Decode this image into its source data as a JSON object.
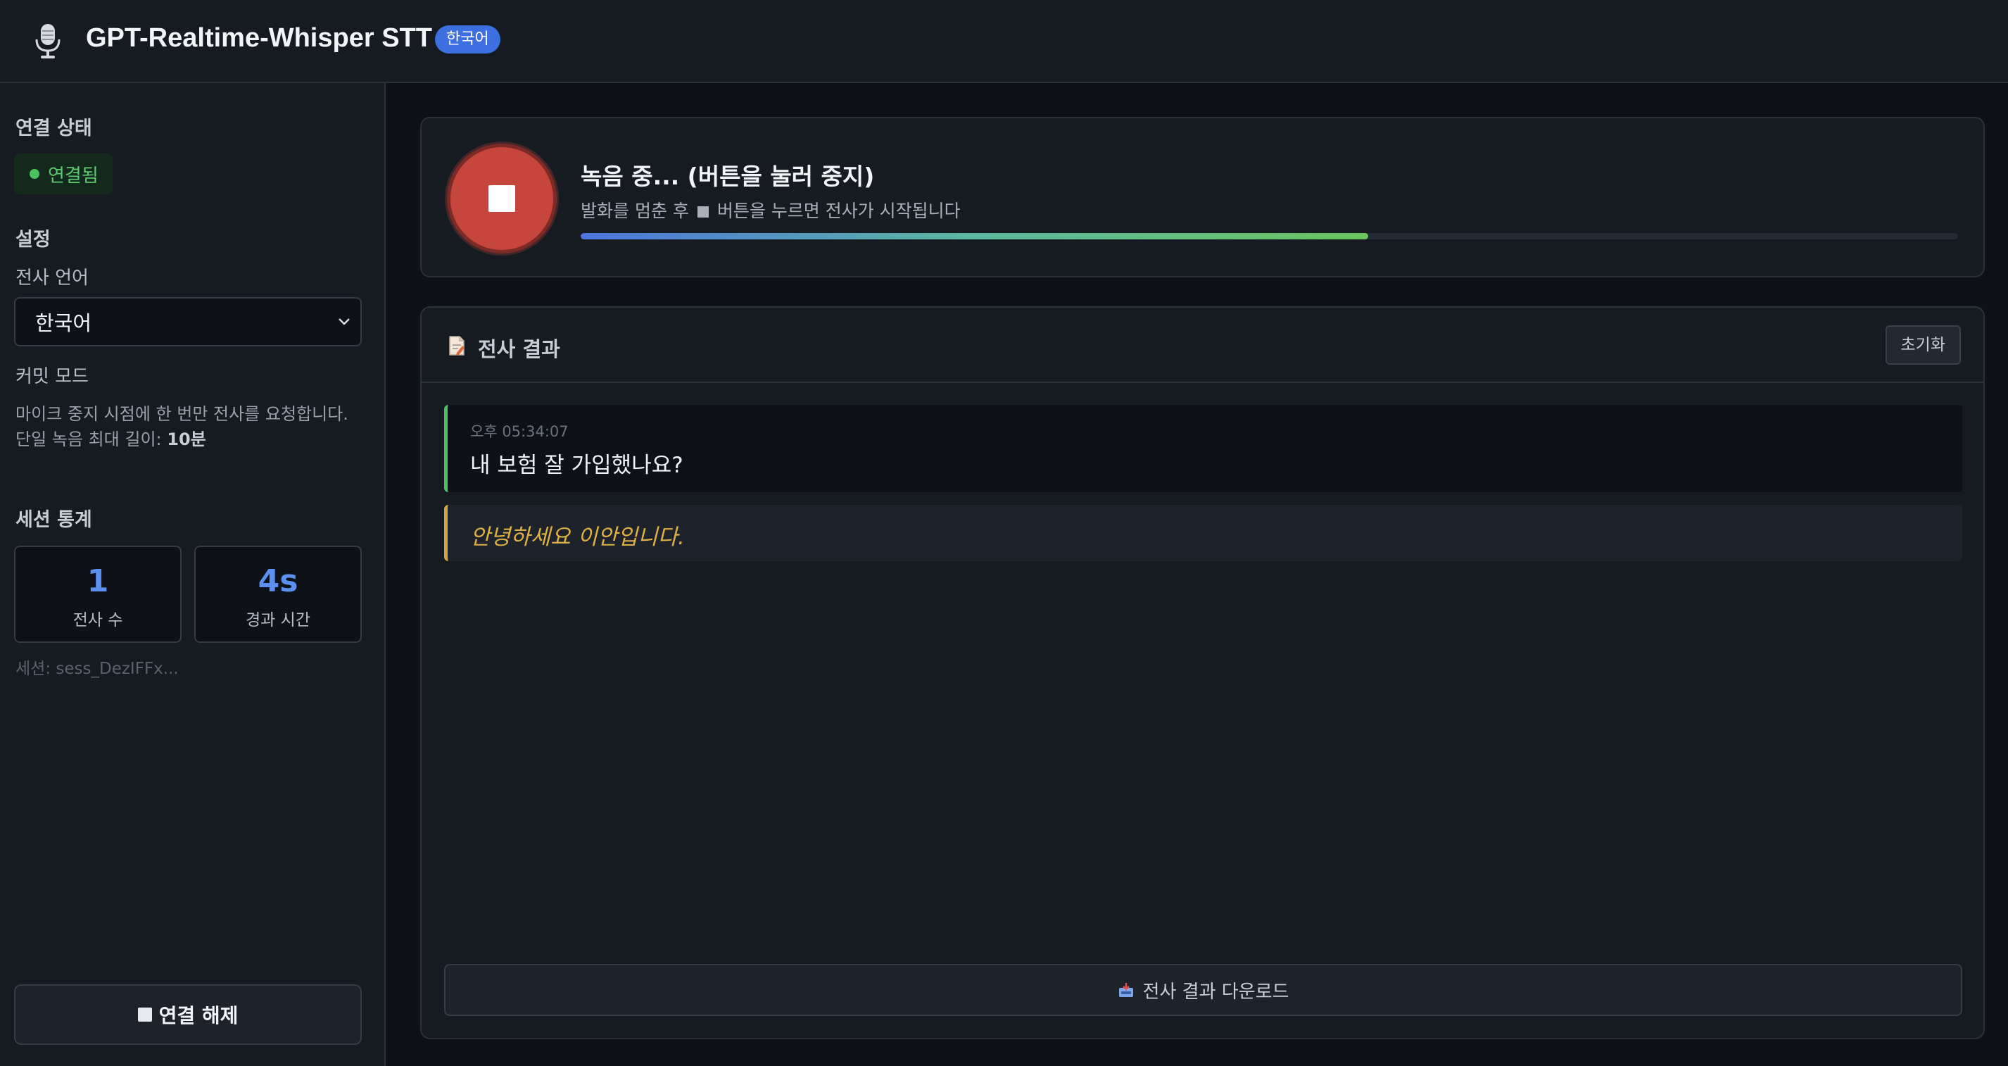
{
  "header": {
    "title": "GPT-Realtime-Whisper STT",
    "language_badge": "한국어",
    "logo_icon": "microphone-icon"
  },
  "sidebar": {
    "connection": {
      "title": "연결 상태",
      "status": "연결됨",
      "status_color": "#4cc05d"
    },
    "settings": {
      "title": "설정",
      "language_label": "전사 언어",
      "language_value": "한국어",
      "commit_mode_label": "커밋 모드",
      "commit_mode_desc": "마이크 중지 시점에 한 번만 전사를 요청합니다.",
      "max_length_label": "단일 녹음 최대 길이: ",
      "max_length_value": "10분"
    },
    "stats": {
      "title": "세션 통계",
      "transcript_count": "1",
      "transcript_count_label": "전사 수",
      "elapsed": "4s",
      "elapsed_label": "경과 시간",
      "session": "세션: sess_DezIFFx..."
    },
    "disconnect_label": "연결 해제"
  },
  "recorder": {
    "title": "녹음 중... (버튼을 눌러 중지)",
    "hint_before": "발화를 멈춘 후",
    "hint_after": "버튼을 누르면 전사가 시작됩니다",
    "level": 0.572,
    "accent_color": "#c6463d"
  },
  "results": {
    "title": "전사 결과",
    "reset_label": "초기화",
    "entries": [
      {
        "time": "오후 05:34:07",
        "text": "내 보험 잘 가입했나요?"
      }
    ],
    "partial_text": "안녕하세요 이안입니다.",
    "download_label": "전사 결과 다운로드"
  }
}
